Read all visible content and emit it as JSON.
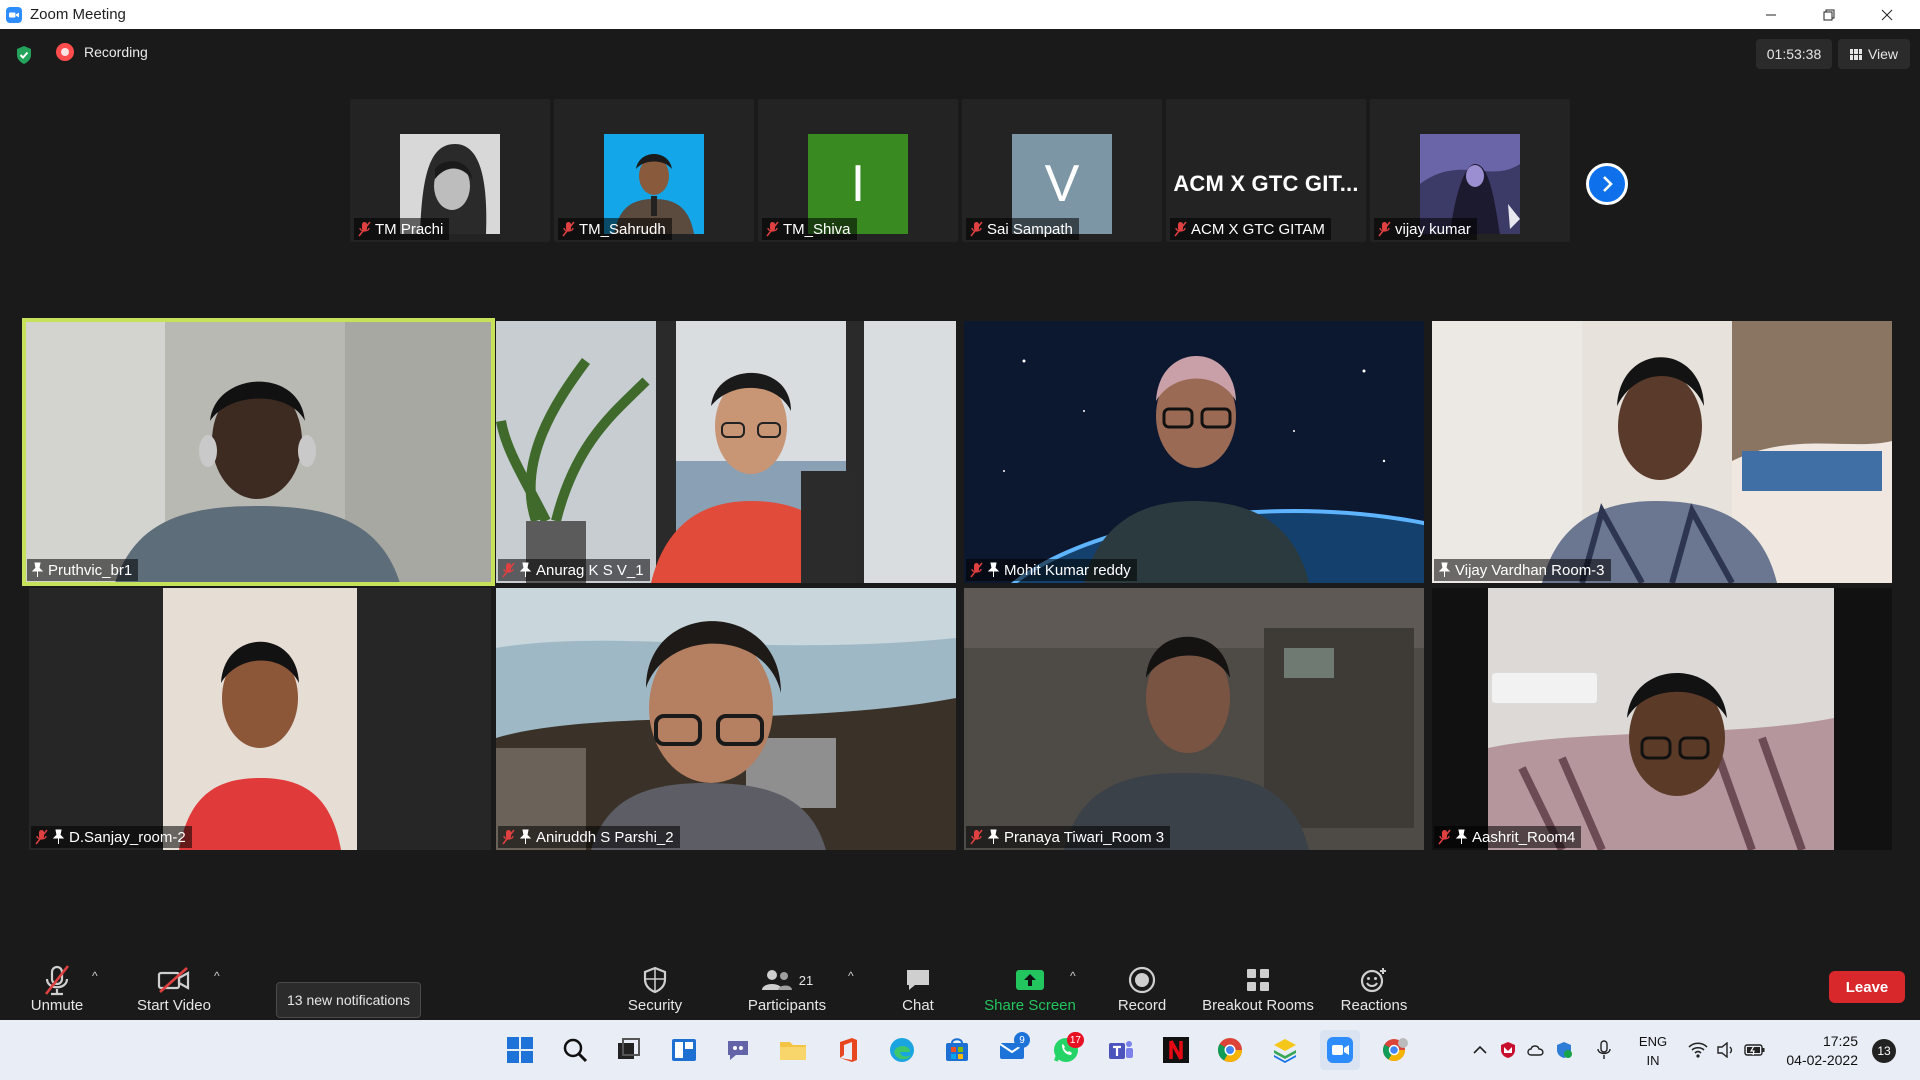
{
  "window": {
    "title": "Zoom Meeting"
  },
  "top": {
    "recording_label": "Recording",
    "timer": "01:53:38",
    "view_label": "View"
  },
  "strip": [
    {
      "name": "TM Prachi",
      "kind": "photo"
    },
    {
      "name": "TM_Sahrudh",
      "kind": "photo"
    },
    {
      "name": "TM_Shiva",
      "kind": "initial",
      "initial": "I",
      "color": "#3a8a22"
    },
    {
      "name": "Sai Sampath",
      "kind": "initial",
      "initial": "V",
      "color": "#7d96a5"
    },
    {
      "name": "ACM X GTC GITAM",
      "kind": "text",
      "display": "ACM X GTC GIT..."
    },
    {
      "name": "vijay kumar",
      "kind": "photo"
    }
  ],
  "grid": [
    {
      "name": "Pruthvic_br1",
      "muted": false,
      "active": true
    },
    {
      "name": "Anurag K S V_1",
      "muted": true,
      "active": false
    },
    {
      "name": "Mohit Kumar reddy",
      "muted": true,
      "active": false
    },
    {
      "name": "Vijay Vardhan Room-3",
      "muted": false,
      "active": false
    },
    {
      "name": "D.Sanjay_room-2",
      "muted": true,
      "active": false
    },
    {
      "name": "Aniruddh S Parshi_2",
      "muted": true,
      "active": false
    },
    {
      "name": "Pranaya Tiwari_Room 3",
      "muted": true,
      "active": false
    },
    {
      "name": "Aashrit_Room4",
      "muted": true,
      "active": false
    }
  ],
  "toolbar": {
    "unmute": "Unmute",
    "start_video": "Start Video",
    "notifications": "13 new notifications",
    "security": "Security",
    "participants": "Participants",
    "participants_count": "21",
    "chat": "Chat",
    "share_screen": "Share Screen",
    "record": "Record",
    "breakout_rooms": "Breakout Rooms",
    "reactions": "Reactions",
    "leave": "Leave"
  },
  "taskbar": {
    "mail_badge": "9",
    "whatsapp_badge": "17",
    "lang_line1": "ENG",
    "lang_line2": "IN",
    "time": "17:25",
    "date": "04-02-2022",
    "notification_count": "13"
  },
  "colors": {
    "accent": "#0e71eb",
    "active_speaker": "#c6e25a",
    "leave": "#d8282b",
    "share": "#22c55e"
  }
}
